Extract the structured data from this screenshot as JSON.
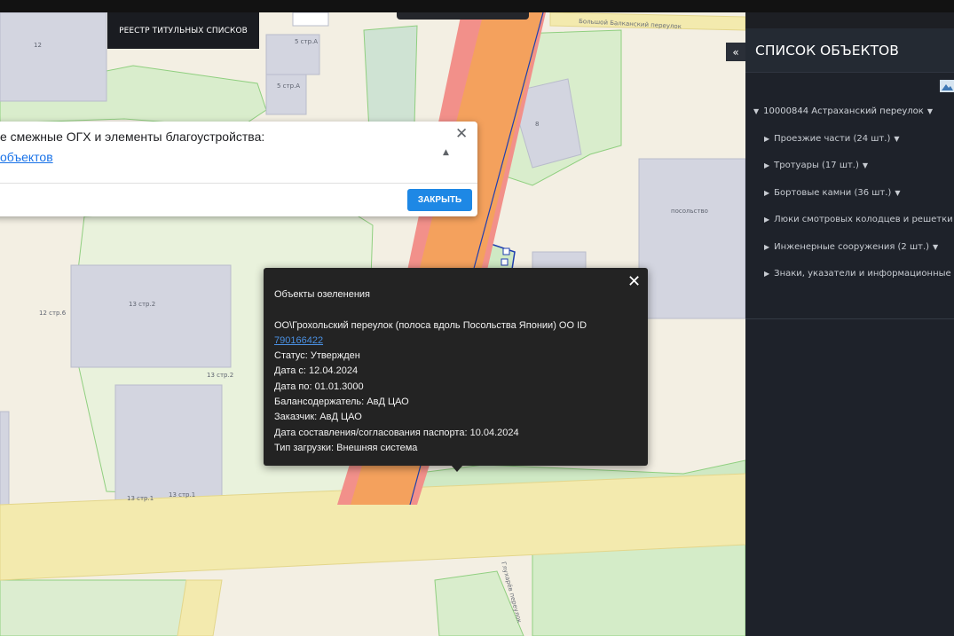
{
  "header": {
    "registry_button": "РЕЕСТР ТИТУЛЬНЫХ СПИСКОВ"
  },
  "map": {
    "street_labels": [
      "Большой Балканский переулок",
      "Глухарёв переулок"
    ],
    "building_labels": [
      "12",
      "5 стр.А",
      "5 стр.А",
      "8",
      "посольство",
      "13 стр.2",
      "12 стр.6",
      "13 стр.2",
      "13 стр.1",
      "13 стр.1"
    ],
    "colors": {
      "background": "#f3efe3",
      "building": "#d3d5e0",
      "building_outline": "#b9bccb",
      "green_zone": "#cfe9c4",
      "green_outline": "#8fcf7f",
      "road": "#f3eaae",
      "orange_road": "#f4a15d",
      "red_zone": "#f2908a",
      "selected_outline": "#1f3fb0"
    }
  },
  "adjacent_dialog": {
    "title": "е смежные ОГХ и элементы благоустройства:",
    "link": "объектов",
    "close_icon": "close-icon",
    "collapse_icon": "chevron-up-icon",
    "close_button": "ЗАКРЫТЬ"
  },
  "info_popup": {
    "heading": "Объекты озеленения",
    "name": "ОО\\Грохольский переулок (полоса вдоль Посольства Японии) ОО ID",
    "id": "790166422",
    "status": "Статус: Утвержден",
    "date_from": "Дата с: 12.04.2024",
    "date_to": "Дата по: 01.01.3000",
    "holder": "Балансодержатель: АвД ЦАО",
    "customer": "Заказчик: АвД ЦАО",
    "passport_date": "Дата составления/согласования паспорта: 10.04.2024",
    "load_type": "Тип загрузки: Внешняя система"
  },
  "panel": {
    "title": "СПИСОК ОБЪЕКТОВ",
    "collapse_label": "«",
    "root": "10000844 Астраханский переулок",
    "items": [
      "Проезжие части (24 шт.)",
      "Тротуары (17 шт.)",
      "Бортовые камни (36 шт.)",
      "Люки смотровых колодцев и решетки",
      "Инженерные сооружения (2 шт.)",
      "Знаки, указатели и информационные"
    ]
  }
}
